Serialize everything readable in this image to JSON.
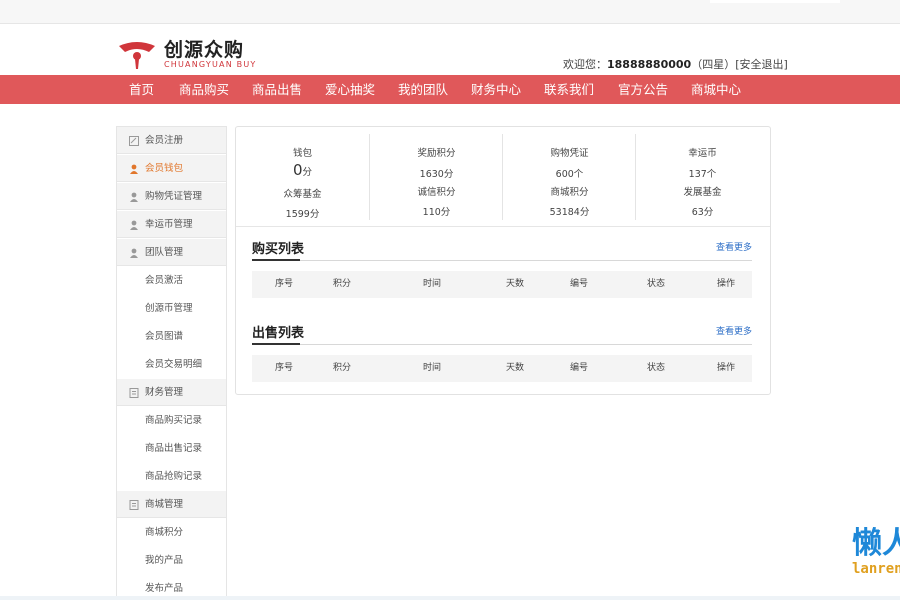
{
  "brand": {
    "name_cn": "创源众购",
    "name_en": "CHUANGYUAN BUY",
    "color": "#d0363b"
  },
  "account": {
    "welcome_prefix": "欢迎您：",
    "phone": "18888880000",
    "level": "（四星）",
    "logout": "[安全退出]"
  },
  "nav": {
    "color": "#e0585a",
    "items": [
      "首页",
      "商品购买",
      "商品出售",
      "爱心抽奖",
      "我的团队",
      "财务中心",
      "联系我们",
      "官方公告",
      "商城中心"
    ]
  },
  "sidebar": {
    "items": [
      {
        "label": "会员注册",
        "type": "group",
        "icon": "edit-icon"
      },
      {
        "label": "会员钱包",
        "type": "group",
        "icon": "user-icon",
        "active": true
      },
      {
        "label": "购物凭证管理",
        "type": "group",
        "icon": "user-icon"
      },
      {
        "label": "幸运币管理",
        "type": "group",
        "icon": "user-icon"
      },
      {
        "label": "团队管理",
        "type": "group",
        "icon": "user-icon"
      },
      {
        "label": "会员激活",
        "type": "sub"
      },
      {
        "label": "创源币管理",
        "type": "sub"
      },
      {
        "label": "会员图谱",
        "type": "sub"
      },
      {
        "label": "会员交易明细",
        "type": "sub"
      },
      {
        "label": "财务管理",
        "type": "group",
        "icon": "document-icon"
      },
      {
        "label": "商品购买记录",
        "type": "sub"
      },
      {
        "label": "商品出售记录",
        "type": "sub"
      },
      {
        "label": "商品抢购记录",
        "type": "sub"
      },
      {
        "label": "商城管理",
        "type": "group",
        "icon": "document-icon"
      },
      {
        "label": "商城积分",
        "type": "sub"
      },
      {
        "label": "我的产品",
        "type": "sub"
      },
      {
        "label": "发布产品",
        "type": "sub"
      }
    ]
  },
  "stats": [
    {
      "label1": "钱包",
      "value1": "0",
      "unit1": "分",
      "label2": "众筹基金",
      "value2": "1599分"
    },
    {
      "label1": "奖励积分",
      "value1": "1630分",
      "unit1": "",
      "label2": "诚信积分",
      "value2": "110分"
    },
    {
      "label1": "购物凭证",
      "value1": "600个",
      "unit1": "",
      "label2": "商城积分",
      "value2": "53184分"
    },
    {
      "label1": "幸运币",
      "value1": "137个",
      "unit1": "",
      "label2": "发展基金",
      "value2": "63分"
    }
  ],
  "buy_list": {
    "title": "购买列表",
    "more": "查看更多",
    "columns": [
      "序号",
      "积分",
      "时间",
      "天数",
      "编号",
      "状态",
      "操作"
    ]
  },
  "sell_list": {
    "title": "出售列表",
    "more": "查看更多",
    "columns": [
      "序号",
      "积分",
      "时间",
      "天数",
      "编号",
      "状态",
      "操作"
    ]
  },
  "watermark": {
    "cn": "懒人",
    "en": "lanren"
  }
}
